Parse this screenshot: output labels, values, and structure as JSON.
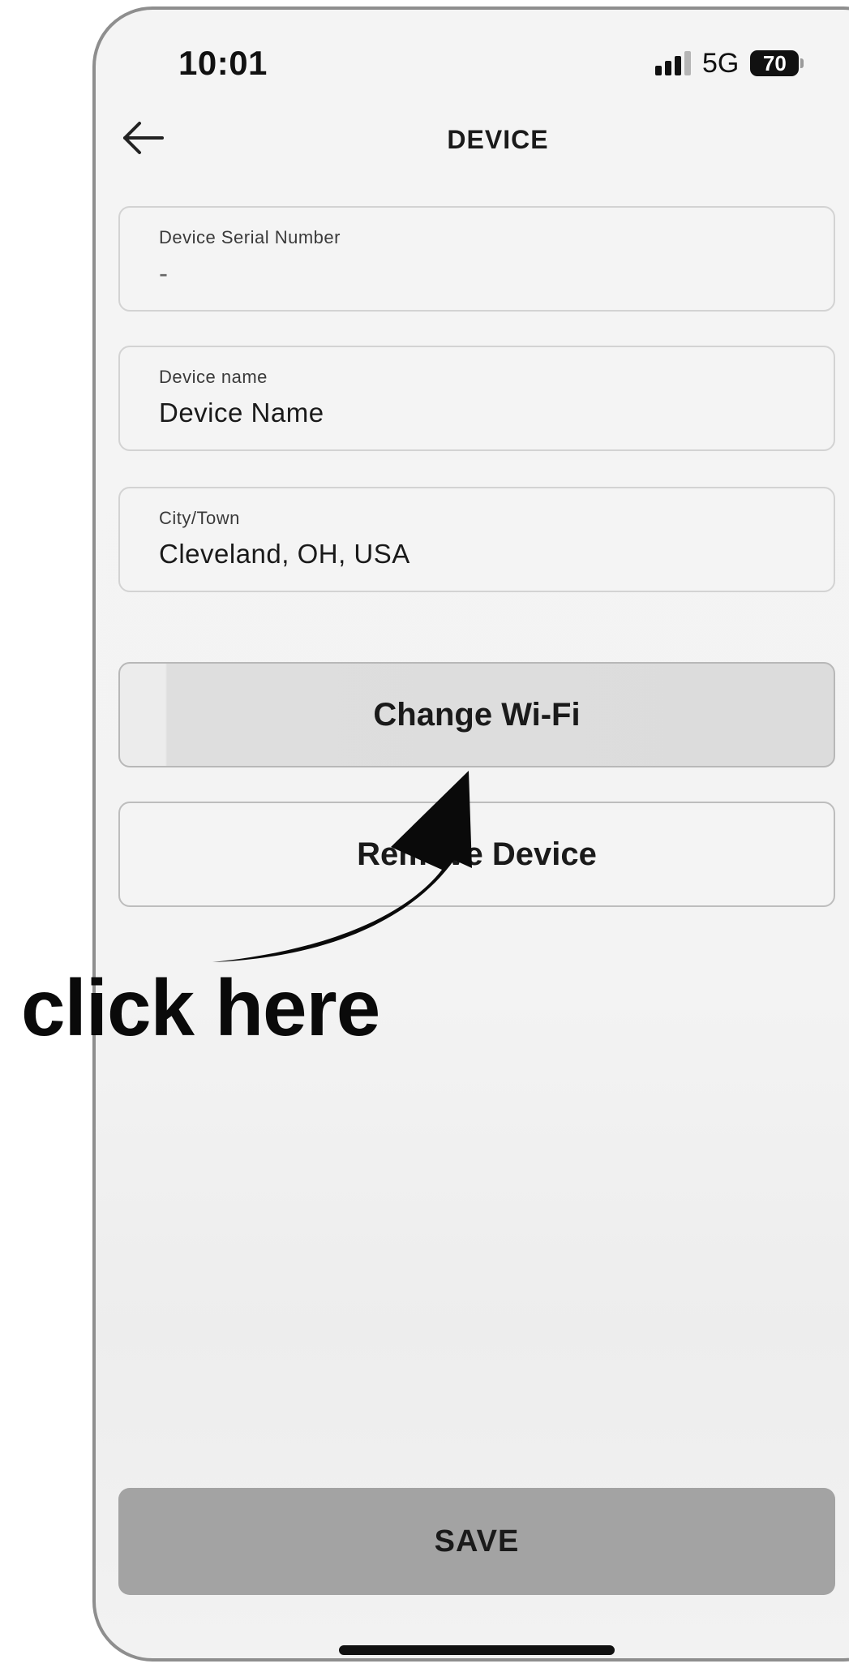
{
  "status_bar": {
    "time": "10:01",
    "network": "5G",
    "battery": "70",
    "icons": [
      "signal-icon",
      "battery-icon"
    ]
  },
  "header": {
    "title": "DEVICE",
    "back_icon": "arrow-left-icon"
  },
  "fields": {
    "serial": {
      "label": "Device Serial Number",
      "value": "-"
    },
    "name": {
      "label": "Device name",
      "value": "Device Name"
    },
    "city": {
      "label": "City/Town",
      "value": "Cleveland, OH, USA"
    }
  },
  "actions": {
    "change_wifi": "Change Wi-Fi",
    "remove_device": "Remove Device",
    "save": "SAVE"
  },
  "annotation": {
    "text": "click here",
    "icon": "curved-arrow-icon"
  },
  "colors": {
    "background": "#f4f4f4",
    "field_border": "#d3d3d3",
    "wifi_button": "#dcdcdc",
    "save_button": "#a3a3a3",
    "text": "#1a1a1a"
  }
}
